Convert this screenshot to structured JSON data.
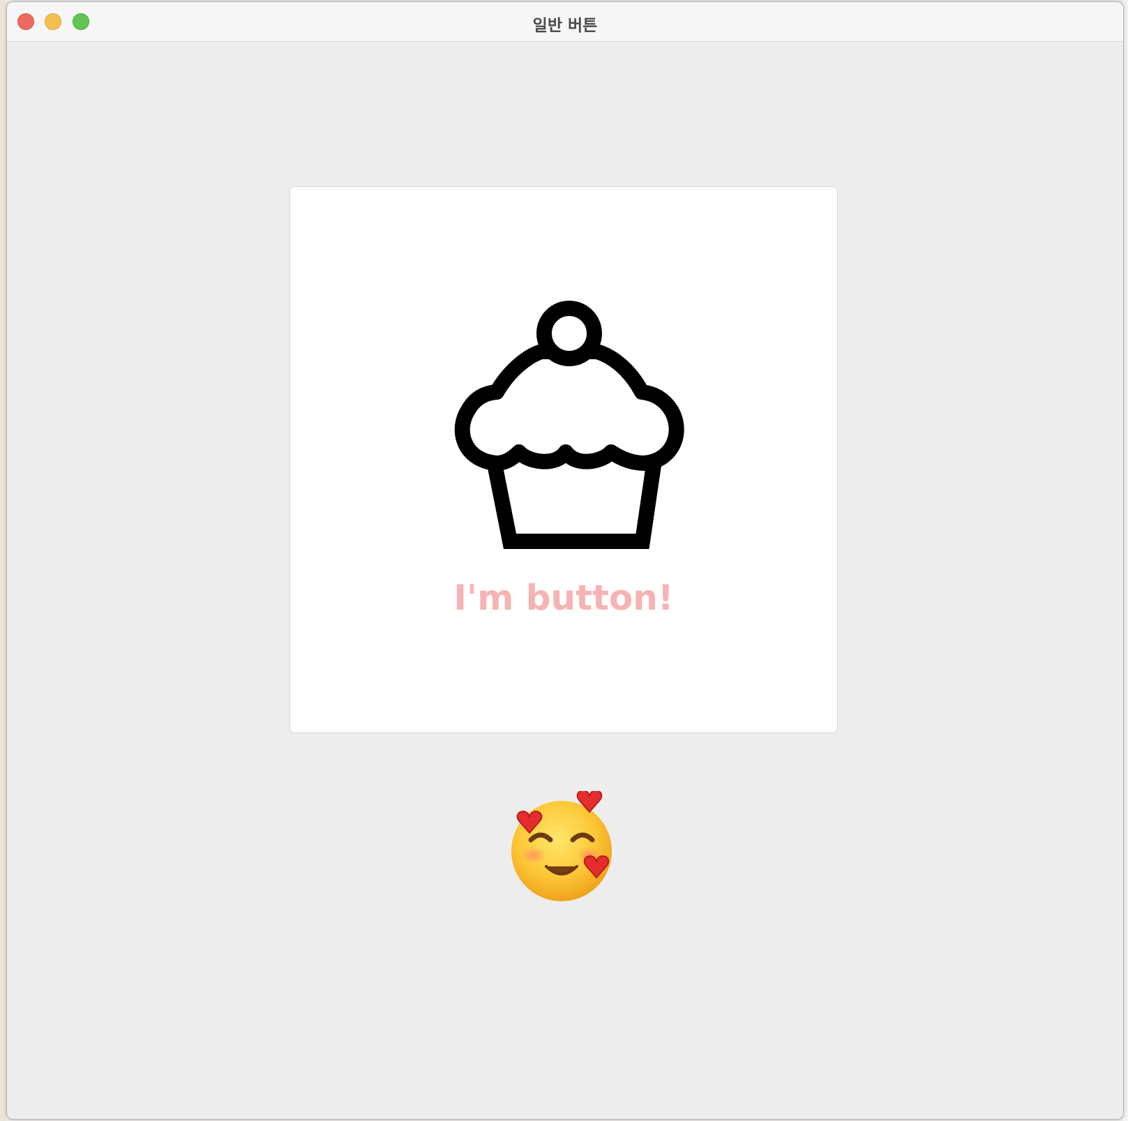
{
  "window": {
    "title": "일반 버튼"
  },
  "main": {
    "button_label": "I'm button!",
    "button_icon": "cupcake-icon",
    "reaction_icon": "smiling-face-with-hearts-emoji"
  },
  "colors": {
    "label": "#f7b3b3",
    "card_background": "#ffffff",
    "window_background": "#ededed",
    "traffic_close": "#ee6a5e",
    "traffic_minimize": "#f5bf4f",
    "traffic_zoom": "#62c554"
  }
}
